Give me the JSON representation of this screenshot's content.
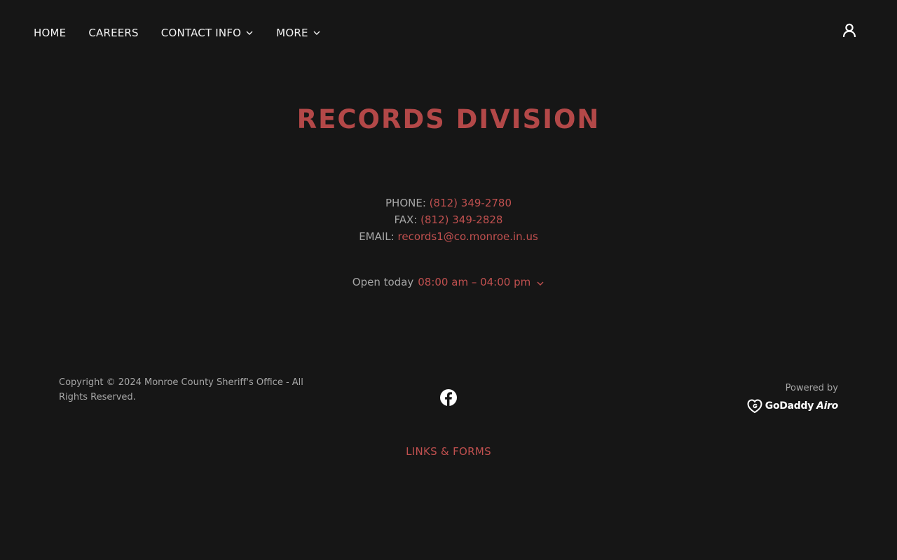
{
  "nav": {
    "items": [
      {
        "label": "HOME",
        "has_dropdown": false
      },
      {
        "label": "CAREERS",
        "has_dropdown": false
      },
      {
        "label": "CONTACT INFO",
        "has_dropdown": true
      },
      {
        "label": "MORE",
        "has_dropdown": true
      }
    ],
    "account_icon": "user-account-icon"
  },
  "main": {
    "title": "RECORDS DIVISION",
    "phone_label": "PHONE:",
    "phone": "(812) 349-2780",
    "fax_label": "FAX:",
    "fax": "(812) 349-2828",
    "email_label": "EMAIL:",
    "email": "records1@co.monroe.in.us",
    "hours_label": "Open today",
    "hours_value": "08:00 am – 04:00 pm"
  },
  "footer": {
    "copyright": "Copyright © 2024 Monroe County Sheriff's Office - All Rights Reserved.",
    "social_icon": "facebook-icon",
    "powered_by": "Powered by",
    "brand_name": "GoDaddy",
    "brand_suffix": "Airo",
    "link": "LINKS & FORMS"
  },
  "colors": {
    "background": "#161616",
    "accent": "#c0504f",
    "title": "#b34848",
    "text": "#a6a6a6",
    "nav_text": "#f2f2f2"
  }
}
